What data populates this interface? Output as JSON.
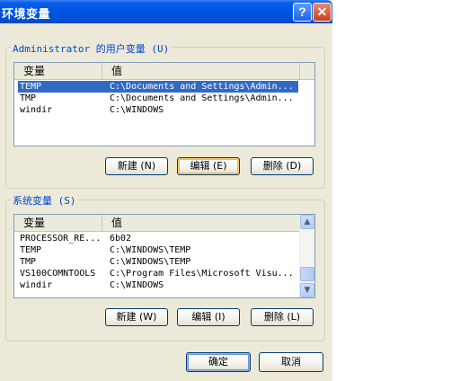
{
  "window": {
    "title": "环境变量",
    "help_label": "?",
    "close_label": "✕"
  },
  "user_vars": {
    "legend": "Administrator 的用户变量 (U)",
    "headers": {
      "name": "变量",
      "value": "值"
    },
    "rows": [
      {
        "name": "TEMP",
        "value": "C:\\Documents and Settings\\Admin...",
        "selected": true
      },
      {
        "name": "TMP",
        "value": "C:\\Documents and Settings\\Admin...",
        "selected": false
      },
      {
        "name": "windir",
        "value": "C:\\WINDOWS",
        "selected": false
      }
    ],
    "buttons": {
      "new": "新建 (N)",
      "edit": "编辑 (E)",
      "delete": "删除 (D)"
    }
  },
  "system_vars": {
    "legend": "系统变量 (S)",
    "headers": {
      "name": "变量",
      "value": "值"
    },
    "rows": [
      {
        "name": "PROCESSOR_RE...",
        "value": "6b02"
      },
      {
        "name": "TEMP",
        "value": "C:\\WINDOWS\\TEMP"
      },
      {
        "name": "TMP",
        "value": "C:\\WINDOWS\\TEMP"
      },
      {
        "name": "VS100COMNTOOLS",
        "value": "C:\\Program Files\\Microsoft Visu..."
      },
      {
        "name": "windir",
        "value": "C:\\WINDOWS"
      }
    ],
    "buttons": {
      "new": "新建 (W)",
      "edit": "编辑 (I)",
      "delete": "删除 (L)"
    }
  },
  "footer": {
    "ok": "确定",
    "cancel": "取消"
  }
}
